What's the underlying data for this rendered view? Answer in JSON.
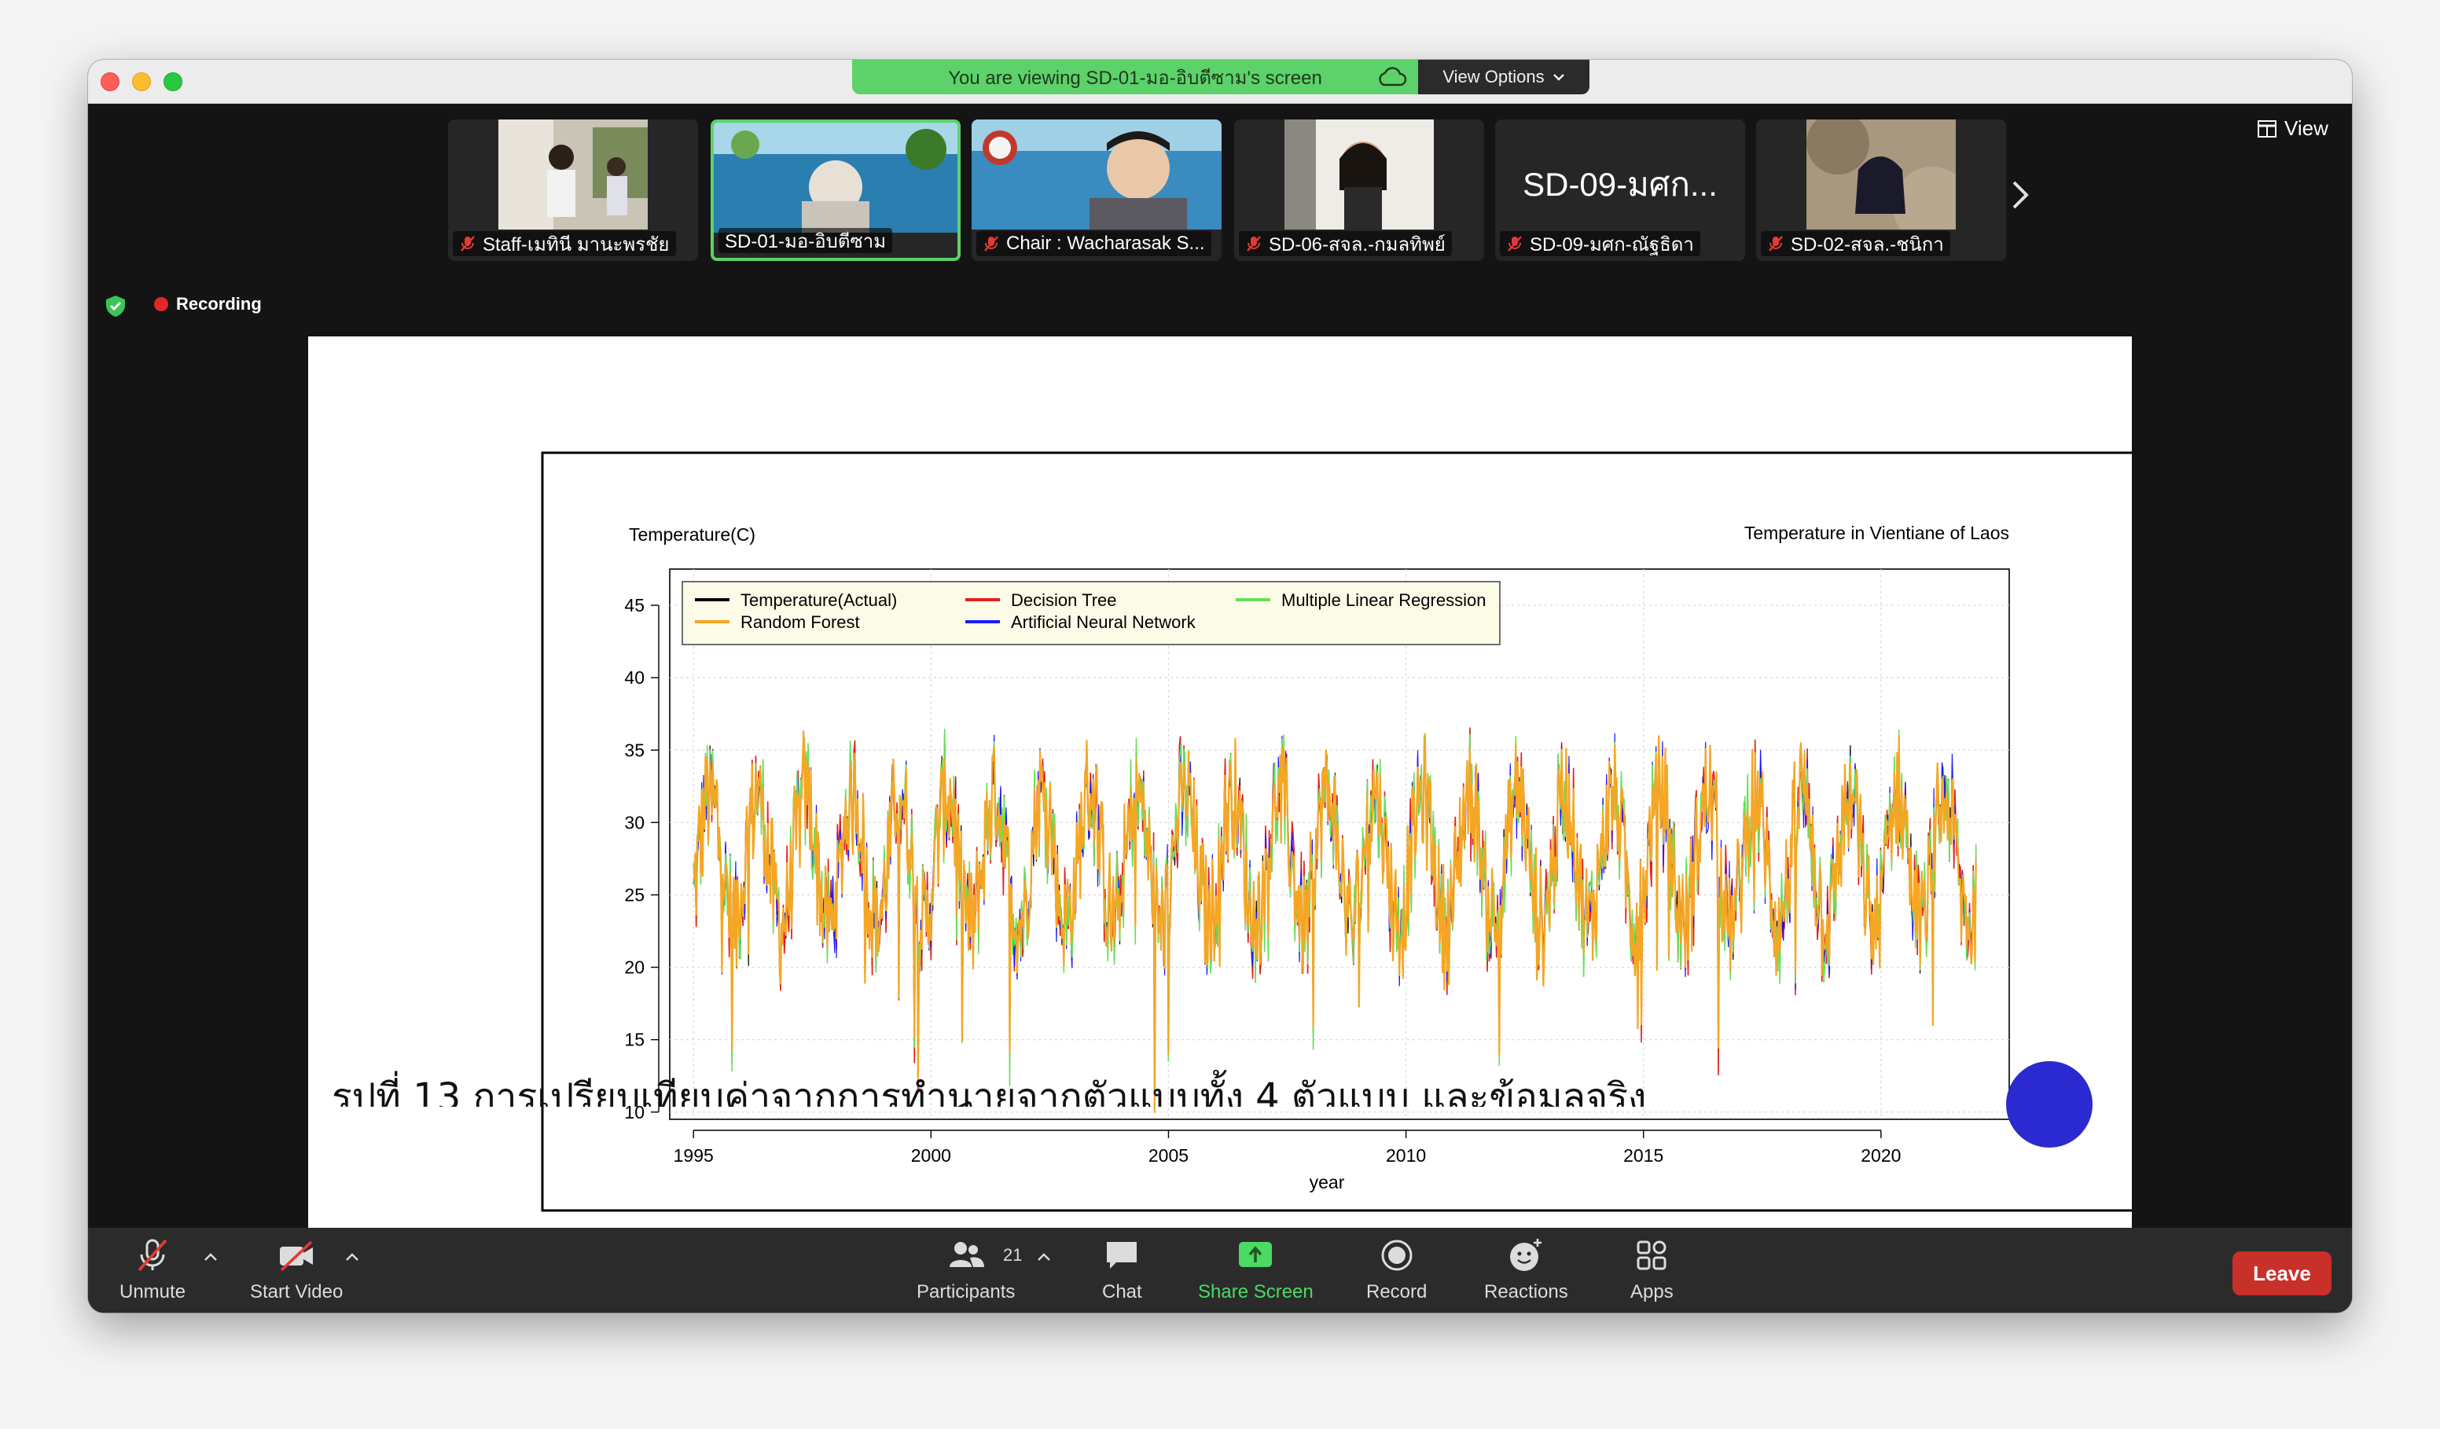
{
  "banner": {
    "viewing_text": "You are viewing SD-01-มอ-อิบตีซาม's screen",
    "view_options_label": "View Options"
  },
  "gallery": {
    "view_label": "View",
    "participants": [
      {
        "name": "Staff-เมทินี มานะพรชัย",
        "muted": true,
        "video": true,
        "active": false
      },
      {
        "name": "SD-01-มอ-อิบตีซาม",
        "muted": false,
        "video": true,
        "active": true
      },
      {
        "name": "Chair : Wacharasak S...",
        "muted": true,
        "video": true,
        "active": false
      },
      {
        "name": "SD-06-สจล.-กมลทิพย์",
        "muted": true,
        "video": true,
        "active": false
      },
      {
        "name": "SD-09-มศก-ณัฐธิดา",
        "big_label": "SD-09-มศก...",
        "muted": true,
        "video": false,
        "active": false
      },
      {
        "name": "SD-02-สจล.-ชนิกา",
        "muted": true,
        "video": true,
        "active": false
      }
    ]
  },
  "status": {
    "recording_label": "Recording"
  },
  "slide": {
    "caption": "รูปที่ 13 การเปรียบเทียบค่าจากการทำนายจากตัวแบบทั้ง 4 ตัวแบบ และข้อมูลจริง"
  },
  "chart_data": {
    "type": "line",
    "title": "Temperature in Vientiane of Laos",
    "xlabel": "year",
    "ylabel": "Temperature(C)",
    "xlim": [
      1995,
      2022
    ],
    "ylim": [
      10,
      45
    ],
    "x_ticks": [
      1995,
      2000,
      2005,
      2010,
      2015,
      2020
    ],
    "y_ticks": [
      10,
      15,
      20,
      25,
      30,
      35,
      40,
      45
    ],
    "grid": true,
    "legend_position": "top-left",
    "legend": [
      {
        "name": "Temperature(Actual)",
        "color": "#000000"
      },
      {
        "name": "Random Forest",
        "color": "#f5a623"
      },
      {
        "name": "Decision Tree",
        "color": "#e02020"
      },
      {
        "name": "Artificial Neural Network",
        "color": "#1a1aff"
      },
      {
        "name": "Multiple Linear Regression",
        "color": "#66e05a"
      }
    ],
    "series_description": "daily temperatures 1995-2022, seasonal oscillation mostly 20-35",
    "seasonal_cycle": {
      "base": 27.5,
      "amplitude": 4.5,
      "period_years": 1,
      "min_observed": 11,
      "max_observed": 36
    }
  },
  "toolbar": {
    "unmute": "Unmute",
    "start_video": "Start Video",
    "participants": "Participants",
    "participants_count": "21",
    "chat": "Chat",
    "share_screen": "Share Screen",
    "record": "Record",
    "reactions": "Reactions",
    "apps": "Apps",
    "leave": "Leave"
  },
  "colors": {
    "share_green": "#5dd16a",
    "leave_red": "#c8302a",
    "toolbar_bg": "#2b2b2b"
  }
}
